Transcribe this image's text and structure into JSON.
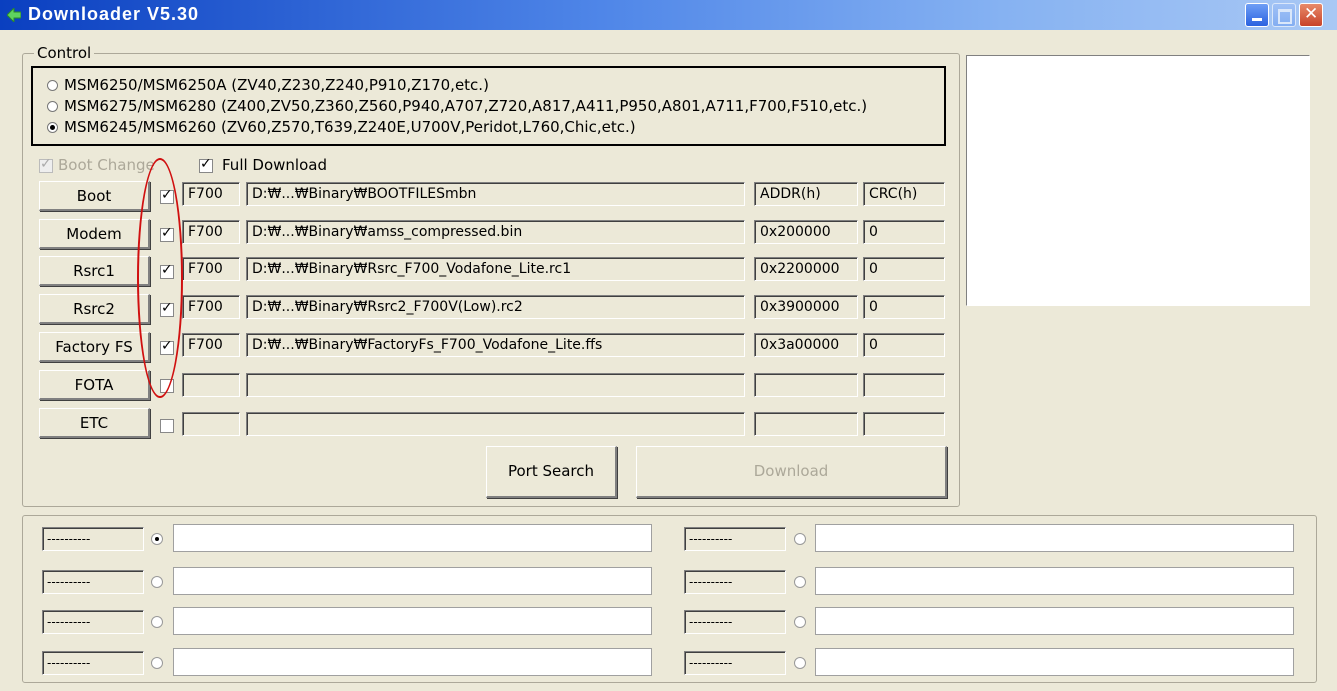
{
  "window": {
    "title": "Downloader V5.30"
  },
  "control": {
    "legend": "Control",
    "models": [
      {
        "label": "MSM6250/MSM6250A (ZV40,Z230,Z240,P910,Z170,etc.)",
        "selected": false
      },
      {
        "label": "MSM6275/MSM6280 (Z400,ZV50,Z360,Z560,P940,A707,Z720,A817,A411,P950,A801,A711,F700,F510,etc.)",
        "selected": false
      },
      {
        "label": "MSM6245/MSM6260 (ZV60,Z570,T639,Z240E,U700V,Peridot,L760,Chic,etc.)",
        "selected": true
      }
    ],
    "boot_change": {
      "label": "Boot Change",
      "checked": true,
      "disabled": true
    },
    "full_download": {
      "label": "Full Download",
      "checked": true
    },
    "header": {
      "addr": "ADDR(h)",
      "crc": "CRC(h)"
    },
    "rows": [
      {
        "button": "Boot",
        "checked": true,
        "model": "F700",
        "path": "D:₩...₩Binary₩BOOTFILESmbn",
        "addr": "ADDR(h)",
        "crc": "CRC(h)"
      },
      {
        "button": "Modem",
        "checked": true,
        "model": "F700",
        "path": "D:₩...₩Binary₩amss_compressed.bin",
        "addr": "0x200000",
        "crc": "0"
      },
      {
        "button": "Rsrc1",
        "checked": true,
        "model": "F700",
        "path": "D:₩...₩Binary₩Rsrc_F700_Vodafone_Lite.rc1",
        "addr": "0x2200000",
        "crc": "0"
      },
      {
        "button": "Rsrc2",
        "checked": true,
        "model": "F700",
        "path": "D:₩...₩Binary₩Rsrc2_F700V(Low).rc2",
        "addr": "0x3900000",
        "crc": "0"
      },
      {
        "button": "Factory FS",
        "checked": true,
        "model": "F700",
        "path": "D:₩...₩Binary₩FactoryFs_F700_Vodafone_Lite.ffs",
        "addr": "0x3a00000",
        "crc": "0"
      },
      {
        "button": "FOTA",
        "checked": false,
        "model": "",
        "path": "",
        "addr": "",
        "crc": ""
      },
      {
        "button": "ETC",
        "checked": false,
        "model": "",
        "path": "",
        "addr": "",
        "crc": ""
      }
    ],
    "port_search": "Port Search",
    "download": "Download"
  },
  "ports": [
    {
      "label": "----------",
      "selected": true,
      "status": ""
    },
    {
      "label": "----------",
      "selected": false,
      "status": ""
    },
    {
      "label": "----------",
      "selected": false,
      "status": ""
    },
    {
      "label": "----------",
      "selected": false,
      "status": ""
    },
    {
      "label": "----------",
      "selected": false,
      "status": ""
    },
    {
      "label": "----------",
      "selected": false,
      "status": ""
    },
    {
      "label": "----------",
      "selected": false,
      "status": ""
    },
    {
      "label": "----------",
      "selected": false,
      "status": ""
    }
  ],
  "colors": {
    "titlebar": "#0a3fc0",
    "face": "#ece9d8",
    "annotation": "#d01010"
  }
}
